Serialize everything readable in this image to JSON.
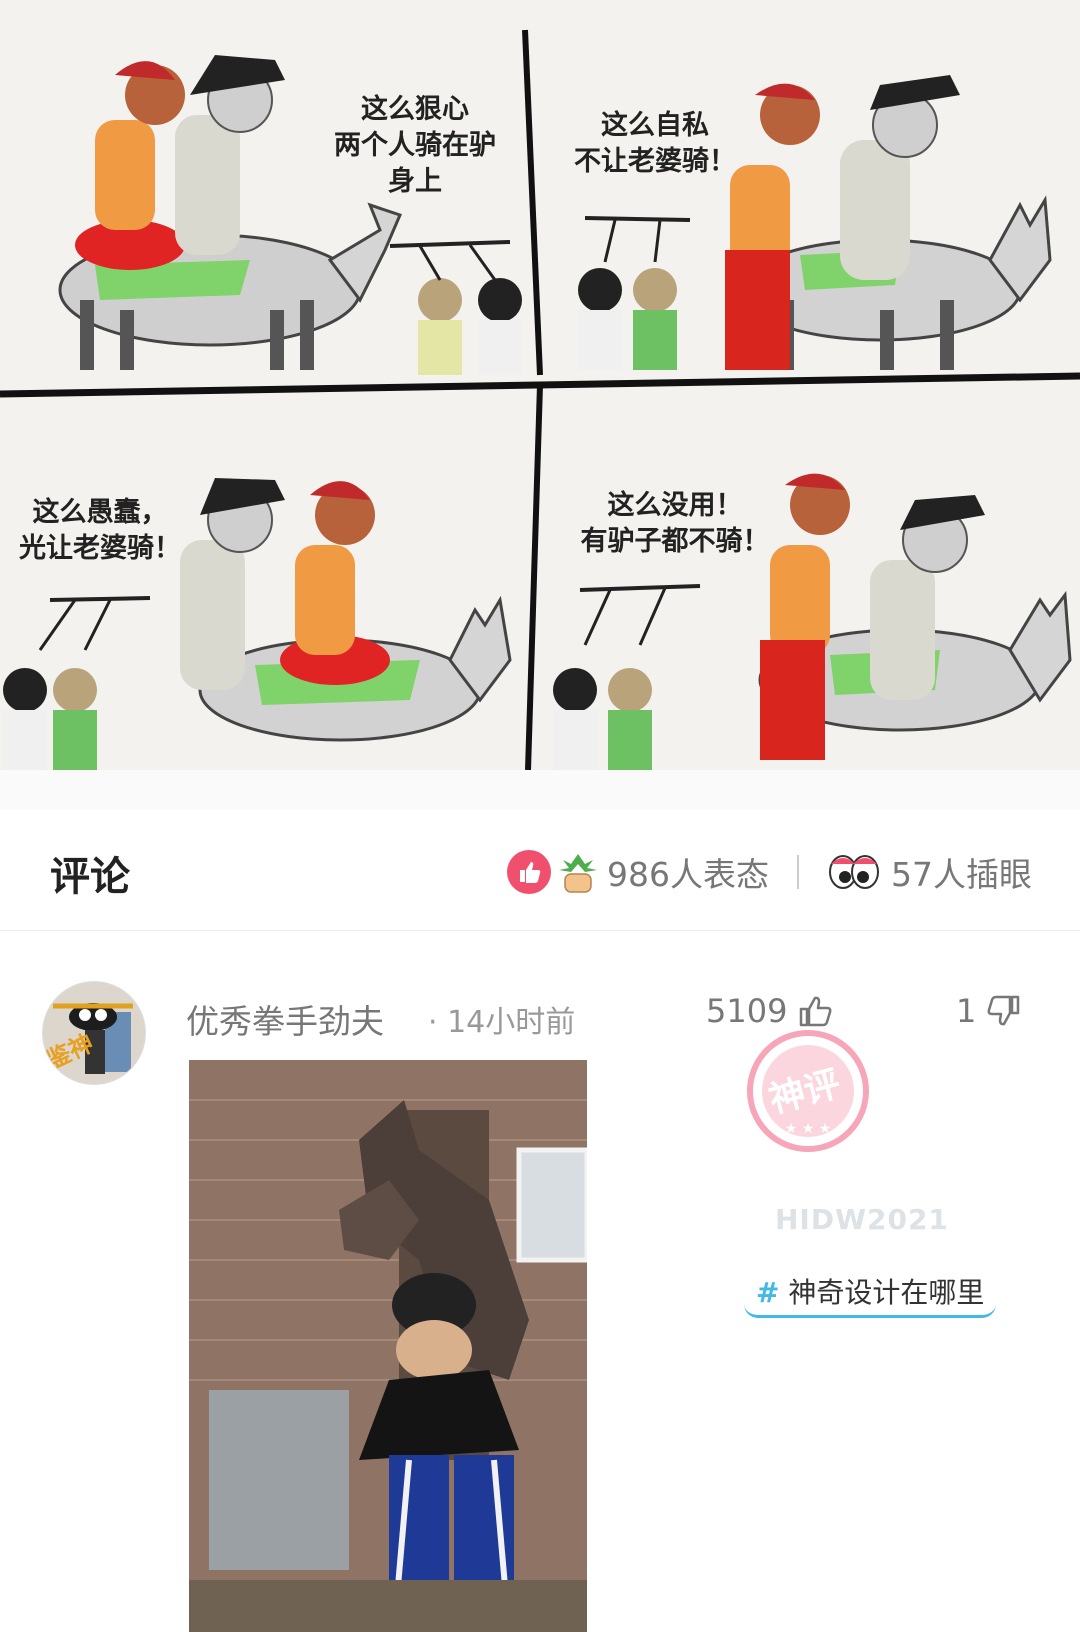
{
  "comic": {
    "panels": [
      {
        "lines": [
          "这么狠心",
          "两个人骑在驴",
          "身上"
        ]
      },
      {
        "lines": [
          "这么自私",
          "不让老婆骑！"
        ]
      },
      {
        "lines": [
          "这么愚蠢，",
          "光让老婆骑！"
        ]
      },
      {
        "lines": [
          "这么没用！",
          "有驴子都不骑！"
        ]
      }
    ]
  },
  "header": {
    "title": "评论",
    "reactions_count": "986人表态",
    "watch_count": "57人插眼"
  },
  "comment": {
    "avatar_text": "鉴神",
    "username": "优秀拳手劲夫",
    "time": "· 14小时前",
    "likes": "5109",
    "dislikes": "1",
    "stamp_text": "神评",
    "watermark": "HIDW2021",
    "tag_hash": "#",
    "tag": "神奇设计在哪里"
  },
  "colors": {
    "accent_blue": "#41b8e6",
    "reaction_pink": "#f0506e",
    "stamp_pink": "#f6a6b8"
  }
}
